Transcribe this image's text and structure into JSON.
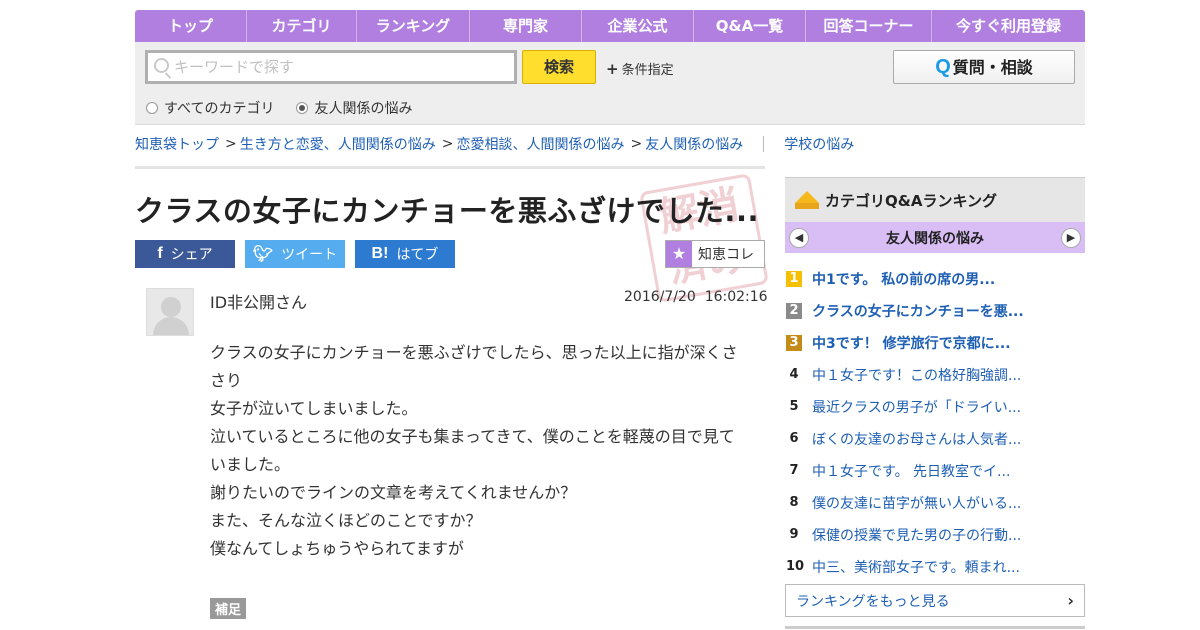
{
  "nav": {
    "items": [
      "トップ",
      "カテゴリ",
      "ランキング",
      "専門家",
      "企業公式",
      "Q&A一覧",
      "回答コーナー",
      "今すぐ利用登録"
    ]
  },
  "search": {
    "placeholder": "キーワードで探す",
    "button": "検索",
    "conditions": "条件指定",
    "ask_button": "質問・相談",
    "ask_icon": "Q",
    "radio_all": "すべてのカテゴリ",
    "radio_category": "友人関係の悩み",
    "selected": "友人関係の悩み"
  },
  "breadcrumb": {
    "items": [
      "知恵袋トップ",
      "生き方と恋愛、人間関係の悩み",
      "恋愛相談、人間関係の悩み",
      "友人関係の悩み"
    ],
    "separator": ">",
    "related": "学校の悩み"
  },
  "question": {
    "title": "クラスの女子にカンチョーを悪ふざけでした...",
    "user": "ID非公開さん",
    "date": "2016/7/20",
    "time": "16:02:16",
    "body": [
      "クラスの女子にカンチョーを悪ふざけでしたら、思った以上に指が深くささり",
      "女子が泣いてしまいました。",
      "泣いているところに他の女子も集まってきて、僕のことを軽蔑の目で見ていました。",
      "謝りたいのでラインの文章を考えてくれませんか？",
      "また、そんな泣くほどのことですか？",
      "僕なんてしょちゅうやられてますが"
    ],
    "supplement_label": "補足",
    "stamp": "解消済み"
  },
  "share": {
    "facebook": "シェア",
    "twitter": "ツイート",
    "hatena": "はてブ",
    "chiekore": "知恵コレ"
  },
  "ranking": {
    "title": "カテゴリQ&Aランキング",
    "category": "友人関係の悩み",
    "items": [
      {
        "rank": "1",
        "text": "中1です。 私の前の席の男..."
      },
      {
        "rank": "2",
        "text": "クラスの女子にカンチョーを悪..."
      },
      {
        "rank": "3",
        "text": "中3です！ 修学旅行で京都に..."
      },
      {
        "rank": "4",
        "text": "中１女子です！この格好胸強調..."
      },
      {
        "rank": "5",
        "text": "最近クラスの男子が「ドライい..."
      },
      {
        "rank": "6",
        "text": "ぼくの友達のお母さんは人気者..."
      },
      {
        "rank": "7",
        "text": "中１女子です。 先日教室でイ..."
      },
      {
        "rank": "8",
        "text": "僕の友達に苗字が無い人がいる..."
      },
      {
        "rank": "9",
        "text": "保健の授業で見た男の子の行動..."
      },
      {
        "rank": "10",
        "text": "中三、美術部女子です。頼まれ..."
      }
    ],
    "more": "ランキングをもっと見る"
  },
  "colors": {
    "nav": "#b07fe0",
    "search_button": "#ffde2e",
    "link": "#1e5fb4",
    "facebook": "#3b5998",
    "twitter": "#55acee",
    "hatena": "#2c7bd0",
    "gold": "#f5c000",
    "silver": "#8a8a8a",
    "bronze": "#c58b18"
  }
}
